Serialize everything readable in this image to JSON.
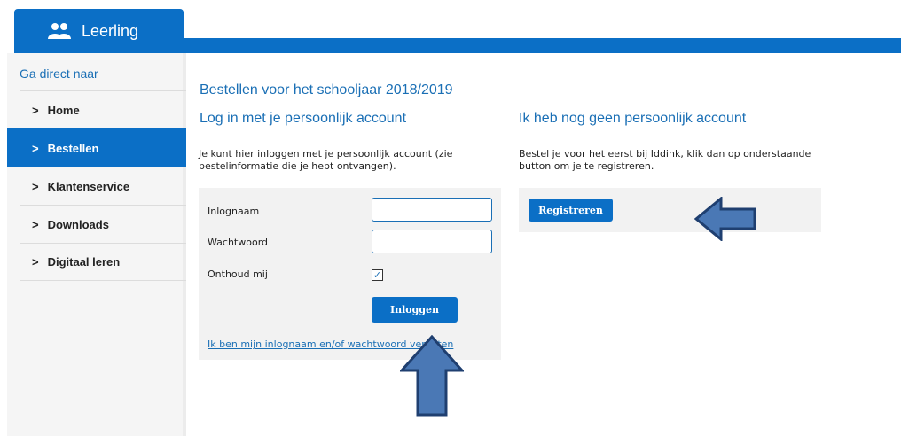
{
  "header": {
    "tab_label": "Leerling",
    "tab_icon": "users-icon"
  },
  "sidebar": {
    "heading": "Ga direct naar",
    "items": [
      {
        "label": "Home",
        "active": false
      },
      {
        "label": "Bestellen",
        "active": true
      },
      {
        "label": "Klantenservice",
        "active": false
      },
      {
        "label": "Downloads",
        "active": false
      },
      {
        "label": "Digitaal leren",
        "active": false
      }
    ]
  },
  "main": {
    "page_title": "Bestellen voor het schooljaar 2018/2019",
    "login": {
      "title": "Log in met je persoonlijk account",
      "description": "Je kunt hier inloggen met je persoonlijk account (zie bestelinformatie die je hebt ontvangen).",
      "username_label": "Inlognaam",
      "username_value": "",
      "password_label": "Wachtwoord",
      "password_value": "",
      "remember_label": "Onthoud mij",
      "remember_checked": true,
      "submit_label": "Inloggen",
      "forgot_link": "Ik ben mijn inlognaam en/of wachtwoord vergeten"
    },
    "register": {
      "title": "Ik heb nog geen persoonlijk account",
      "description": "Bestel je voor het eerst bij Iddink, klik dan op onderstaande button om je te registreren.",
      "button_label": "Registreren"
    }
  },
  "colors": {
    "brand_blue": "#0b6fc6",
    "heading_blue": "#1a6fb5",
    "arrow_fill": "#4a78b5",
    "arrow_stroke": "#1f3f70"
  }
}
